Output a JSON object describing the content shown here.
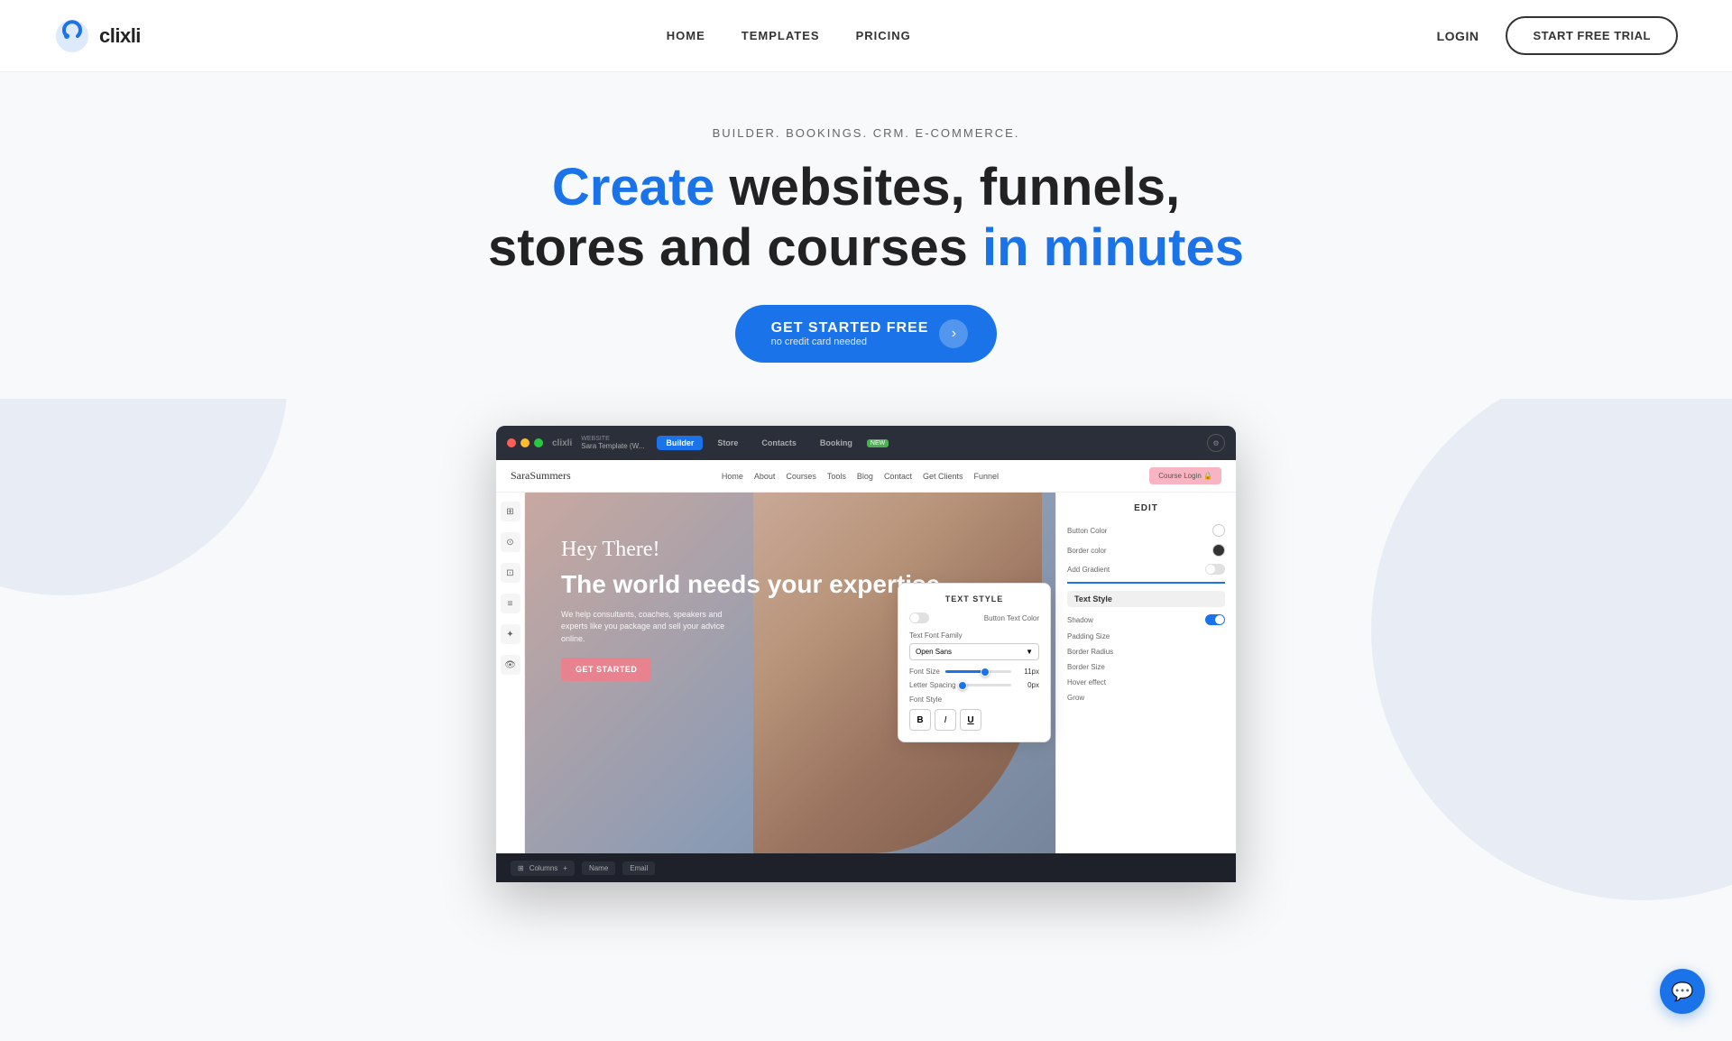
{
  "nav": {
    "logo_text": "clixli",
    "links": [
      "HOME",
      "TEMPLATES",
      "PRICING"
    ],
    "login": "LOGIN",
    "start_trial": "START FREE TRIAL"
  },
  "hero": {
    "sub": "BUILDER. BOOKINGS. CRM. E-COMMERCE.",
    "title_part1": "Create",
    "title_part2": " websites, funnels,",
    "title_part3": "stores and courses ",
    "title_part4": "in minutes",
    "cta_main": "GET STARTED FREE",
    "cta_sub": "no credit card needed",
    "cta_arrow": "›"
  },
  "browser_mockup": {
    "brand": "clixli",
    "site_name": "Sara Template (W...",
    "tabs": [
      "Builder",
      "Store",
      "Contacts",
      "Booking"
    ],
    "new_badge": "NEW"
  },
  "inner_nav": {
    "logo": "SaraSummers",
    "links": [
      "Home",
      "About",
      "Courses",
      "Tools",
      "Blog",
      "Contact",
      "Get Clients",
      "Funnel"
    ],
    "cta": "Course Login 🔒"
  },
  "inner_hero": {
    "hey_there": "Hey There!",
    "title": "The world needs your expertise.",
    "sub": "We help consultants, coaches, speakers and experts like you package and sell your advice online.",
    "cta": "GET STARTED"
  },
  "edit_panel": {
    "title": "EDIT",
    "button_color_label": "Button Color",
    "border_color_label": "Border color",
    "add_gradient_label": "Add Gradient",
    "text_style_label": "Text Style",
    "shadow_label": "Shadow",
    "padding_size_label": "Padding Size",
    "border_radius_label": "Border Radius",
    "border_size_label": "Border Size",
    "hover_effect_label": "Hover effect",
    "grow_label": "Grow"
  },
  "text_style_popup": {
    "title": "TEXT STYLE",
    "btn_text_color_label": "Button Text Color",
    "font_family_label": "Text Font Family",
    "font_family_value": "Open Sans",
    "font_size_label": "Font Size",
    "font_size_value": "11px",
    "font_size_percent": 60,
    "letter_spacing_label": "Letter Spacing",
    "letter_spacing_value": "0px",
    "letter_spacing_percent": 0,
    "font_style_label": "Font Style",
    "bold": "B",
    "italic": "I",
    "underline": "U"
  },
  "sidebar_tools": [
    "⊞",
    "⊙",
    "⊡",
    "≡",
    "✦",
    "👁"
  ],
  "bottom_bar": {
    "columns_label": "Columns",
    "plus": "+",
    "name_label": "Name",
    "email_label": "Email"
  },
  "chat": {
    "icon": "💬"
  }
}
